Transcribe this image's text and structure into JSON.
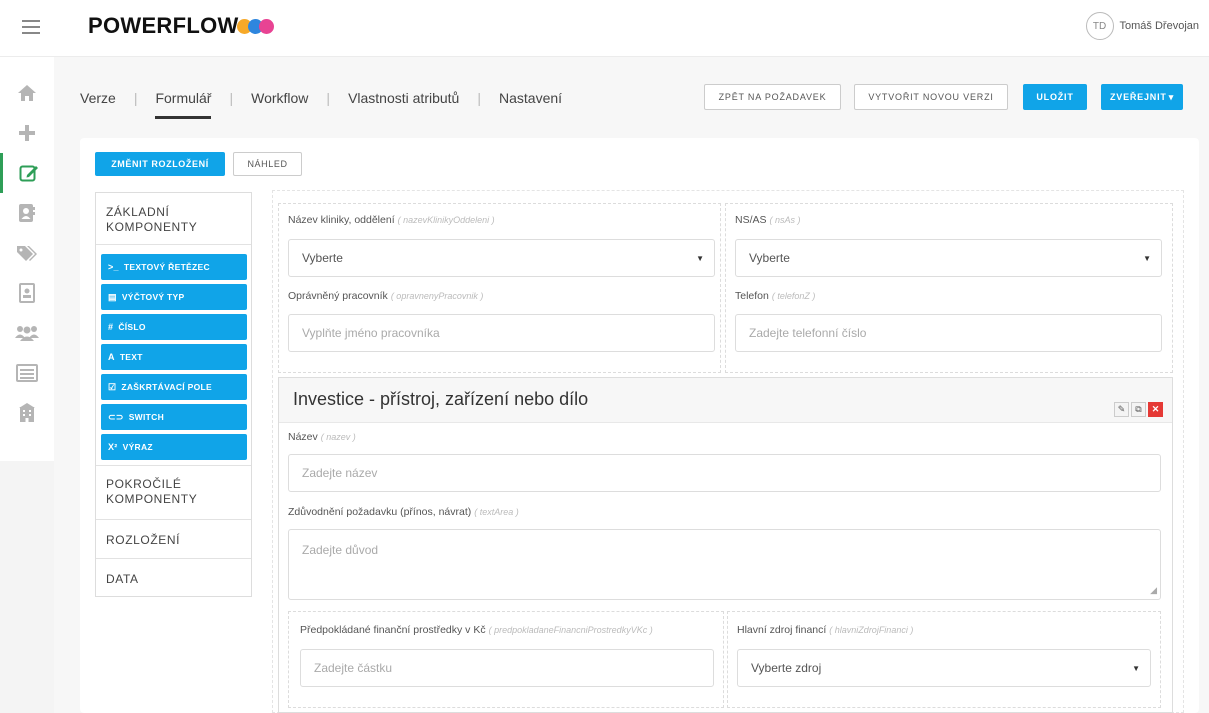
{
  "header": {
    "logo_text": "POWERFLOW",
    "logo_dot_colors": [
      "#f7a928",
      "#2e86de",
      "#e84393"
    ],
    "user": {
      "initials": "TD",
      "name": "Tomáš Dřevojan"
    }
  },
  "sidebar": {
    "items": [
      {
        "icon": "home-icon",
        "active": false
      },
      {
        "icon": "plus-icon",
        "active": false
      },
      {
        "icon": "edit-form-icon",
        "active": true
      },
      {
        "icon": "contacts-icon",
        "active": false
      },
      {
        "icon": "tags-icon",
        "active": false
      },
      {
        "icon": "id-card-icon",
        "active": false
      },
      {
        "icon": "users-icon",
        "active": false
      },
      {
        "icon": "list-icon",
        "active": false
      },
      {
        "icon": "building-icon",
        "active": false
      }
    ]
  },
  "tabs": [
    {
      "label": "Verze",
      "active": false
    },
    {
      "label": "Formulář",
      "active": true
    },
    {
      "label": "Workflow",
      "active": false
    },
    {
      "label": "Vlastnosti atributů",
      "active": false
    },
    {
      "label": "Nastavení",
      "active": false
    }
  ],
  "actions": {
    "back": "Zpět na požadavek",
    "new_version": "Vytvořit novou verzi",
    "save": "Uložit",
    "publish": "Zveřejnit",
    "publish_caret": "▾"
  },
  "toolbar": {
    "change_layout": "Změnit rozložení",
    "preview": "Náhled"
  },
  "components": {
    "basic_heading": "Základní komponenty",
    "basic_items": [
      {
        "icon_glyph": ">_",
        "label": "Textový řetězec"
      },
      {
        "icon_glyph": "▤",
        "label": "Výčtový typ"
      },
      {
        "icon_glyph": "#",
        "label": "Číslo"
      },
      {
        "icon_glyph": "A",
        "label": "Text"
      },
      {
        "icon_glyph": "☑",
        "label": "Zaškrtávací pole"
      },
      {
        "icon_glyph": "⊂⊃",
        "label": "Switch"
      },
      {
        "icon_glyph": "x²",
        "label": "Výraz"
      }
    ],
    "advanced_heading": "Pokročilé komponenty",
    "layout_heading": "Rozložení",
    "data_heading": "Data"
  },
  "form": {
    "fields_top": [
      {
        "label": "Název kliniky, oddělení",
        "key": "( nazevKlinikyOddeleni )",
        "value": "Vyberte",
        "type": "select"
      },
      {
        "label": "NS/AS",
        "key": "( nsAs )",
        "value": "Vyberte",
        "type": "select"
      },
      {
        "label": "Oprávněný pracovník",
        "key": "( opravnenyPracovnik )",
        "placeholder": "Vyplňte jméno pracovníka",
        "type": "input"
      },
      {
        "label": "Telefon",
        "key": "( telefonZ )",
        "placeholder": "Zadejte telefonní číslo",
        "type": "input"
      }
    ],
    "section": {
      "title": "Investice - přístroj, zařízení nebo dílo",
      "name_label": "Název",
      "name_key": "( nazev )",
      "name_placeholder": "Zadejte název",
      "reason_label": "Zdůvodnění požadavku (přínos, návrat)",
      "reason_key": "( textArea )",
      "reason_placeholder": "Zadejte důvod",
      "funds_label": "Předpokládané finanční prostředky v Kč",
      "funds_key": "( predpokladaneFinancniProstredkyVKc )",
      "funds_placeholder": "Zadejte částku",
      "source_label": "Hlavní zdroj financí",
      "source_key": "( hlavniZdrojFinanci )",
      "source_value": "Vyberte zdroj"
    }
  }
}
